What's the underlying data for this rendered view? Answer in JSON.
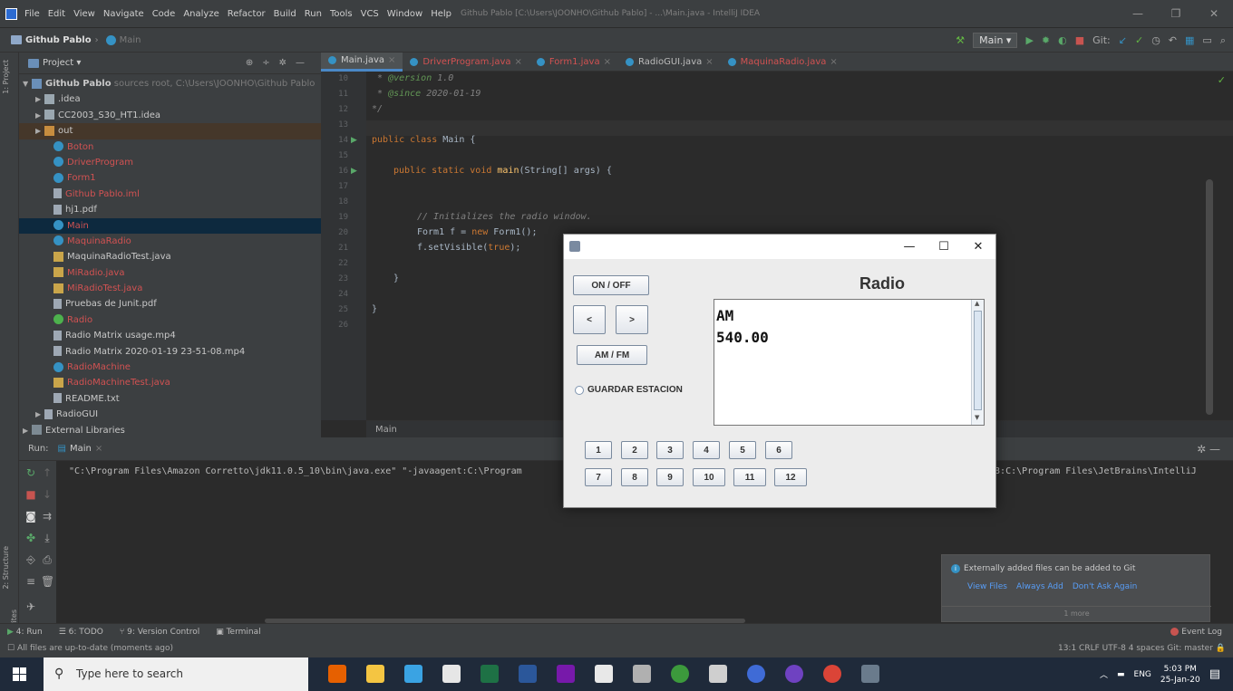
{
  "title_bar": {
    "menu": [
      "File",
      "Edit",
      "View",
      "Navigate",
      "Code",
      "Analyze",
      "Refactor",
      "Build",
      "Run",
      "Tools",
      "VCS",
      "Window",
      "Help"
    ],
    "window_title": "Github Pablo [C:\\Users\\JOONHO\\Github Pablo] - ...\\Main.java - IntelliJ IDEA",
    "controls": [
      "—",
      "❐",
      "✕"
    ]
  },
  "nav_bar": {
    "project": "Github Pablo",
    "file": "Main",
    "run_config": "Main ▾",
    "git_label": "Git:"
  },
  "project_panel": {
    "header": "Project ▾",
    "root_name": "Github Pablo",
    "root_note": "sources root, C:\\Users\\JOONHO\\Github Pablo",
    "items": [
      {
        "label": ".idea"
      },
      {
        "label": "CC2003_S30_HT1.idea"
      },
      {
        "label": "out"
      },
      {
        "label": "Boton"
      },
      {
        "label": "DriverProgram"
      },
      {
        "label": "Form1"
      },
      {
        "label": "Github Pablo.iml"
      },
      {
        "label": "hj1.pdf"
      },
      {
        "label": "Main"
      },
      {
        "label": "MaquinaRadio"
      },
      {
        "label": "MaquinaRadioTest.java"
      },
      {
        "label": "MiRadio.java"
      },
      {
        "label": "MiRadioTest.java"
      },
      {
        "label": "Pruebas de Junit.pdf"
      },
      {
        "label": "Radio"
      },
      {
        "label": "Radio Matrix usage.mp4"
      },
      {
        "label": "Radio Matrix 2020-01-19 23-51-08.mp4"
      },
      {
        "label": "RadioMachine"
      },
      {
        "label": "RadioMachineTest.java"
      },
      {
        "label": "README.txt"
      },
      {
        "label": "RadioGUI"
      },
      {
        "label": "External Libraries"
      }
    ]
  },
  "editor": {
    "tabs": [
      "Main.java",
      "DriverProgram.java",
      "Form1.java",
      "RadioGUI.java",
      "MaquinaRadio.java"
    ],
    "line_numbers": [
      "10",
      "11",
      "12",
      "13",
      "14",
      "15",
      "16",
      "17",
      "18",
      "19",
      "20",
      "21",
      "22",
      "23",
      "24",
      "25",
      "26"
    ],
    "code": {
      "l10_tag": "@version",
      "l10_val": " 1.0",
      "l11_tag": "@since",
      "l11_val": " 2020-01-19",
      "l12": "*/",
      "l14_kw": "public class",
      "l14_rest": " Main {",
      "l16_kw": "public static void",
      "l16_fn": " main",
      "l16_rest": "(String[] args) {",
      "l19": "// Initializes the radio window.",
      "l20_a": "Form1 f = ",
      "l20_kw": "new",
      "l20_b": " Form1();",
      "l21_a": "f.setVisible(",
      "l21_kw": "true",
      "l21_b": ");",
      "l23": "}",
      "l25": "}"
    },
    "breadcrumb": "Main"
  },
  "run_panel": {
    "label": "Run:",
    "tab": "Main",
    "console_left": "\"C:\\Program Files\\Amazon Corretto\\jdk11.0.5_10\\bin\\java.exe\" \"-javaagent:C:\\Program",
    "console_right": "538:C:\\Program Files\\JetBrains\\IntelliJ"
  },
  "notification": {
    "text": "Externally added files can be added to Git",
    "links": [
      "View Files",
      "Always Add",
      "Don't Ask Again"
    ],
    "more": "1 more"
  },
  "bottom_bar": {
    "tabs": [
      "4: Run",
      "6: TODO",
      "9: Version Control",
      "Terminal"
    ],
    "event_log": "Event Log",
    "status": "All files are up-to-date (moments ago)",
    "right": "13:1  CRLF  UTF-8  4 spaces  Git: master"
  },
  "taskbar": {
    "search_placeholder": "Type here to search",
    "lang": "ENG",
    "time": "5:03 PM",
    "date": "25-Jan-20"
  },
  "radio_window": {
    "title_controls": [
      "—",
      "☐",
      "✕"
    ],
    "on_off": "ON / OFF",
    "prev": "<",
    "next": ">",
    "am_fm": "AM / FM",
    "heading": "Radio",
    "band": "AM",
    "frequency": "540.00",
    "save_station": "GUARDAR ESTACION",
    "presets": [
      "1",
      "2",
      "3",
      "4",
      "5",
      "6",
      "7",
      "8",
      "9",
      "10",
      "11",
      "12"
    ]
  }
}
